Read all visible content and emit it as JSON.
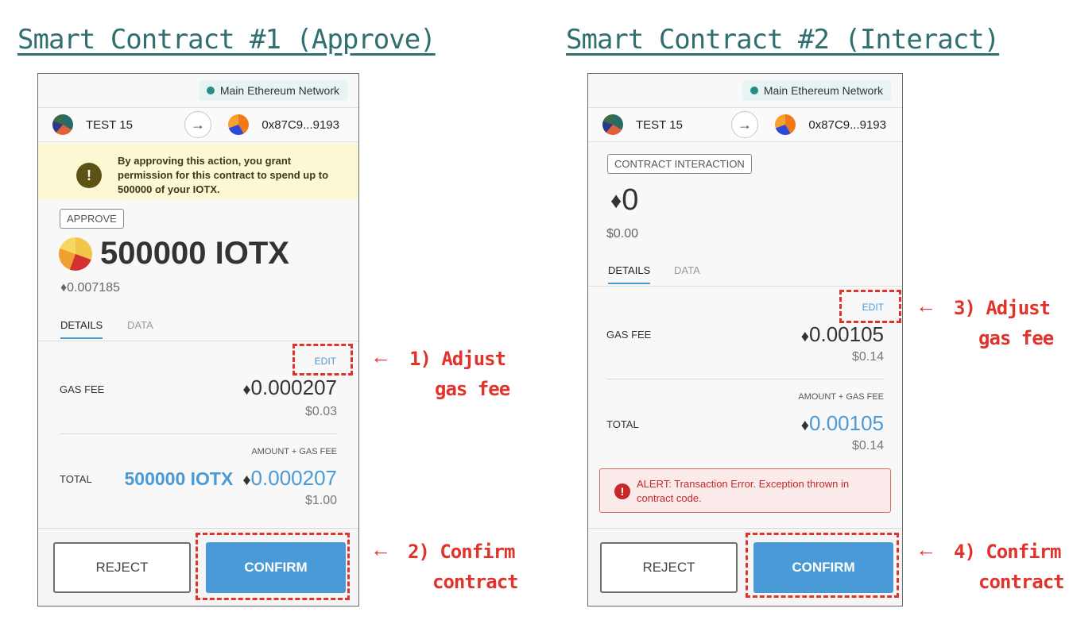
{
  "headings": {
    "left": "Smart Contract #1 (Approve)",
    "right": "Smart Contract #2 (Interact)"
  },
  "panel1": {
    "network": "Main Ethereum Network",
    "from_account": "TEST 15",
    "to_address": "0x87C9...9193",
    "warning": "By approving this action, you grant permission for this contract to spend up to 500000 of your IOTX.",
    "tag": "APPROVE",
    "amount": "500000 IOTX",
    "eth_amount": "0.007185",
    "tabs": [
      "DETAILS",
      "DATA"
    ],
    "edit": "EDIT",
    "gas_fee_label": "GAS FEE",
    "gas_fee_eth": "0.000207",
    "gas_fee_usd": "$0.03",
    "amount_gas_label": "AMOUNT + GAS FEE",
    "total_label": "TOTAL",
    "total_token": "500000 IOTX",
    "total_eth": "0.000207",
    "total_usd": "$1.00",
    "reject": "REJECT",
    "confirm": "CONFIRM"
  },
  "panel2": {
    "network": "Main Ethereum Network",
    "from_account": "TEST 15",
    "to_address": "0x87C9...9193",
    "tag": "CONTRACT INTERACTION",
    "amount": "0",
    "usd_amount": "$0.00",
    "tabs": [
      "DETAILS",
      "DATA"
    ],
    "edit": "EDIT",
    "gas_fee_label": "GAS FEE",
    "gas_fee_eth": "0.00105",
    "gas_fee_usd": "$0.14",
    "amount_gas_label": "AMOUNT + GAS FEE",
    "total_label": "TOTAL",
    "total_eth": "0.00105",
    "total_usd": "$0.14",
    "alert": "ALERT: Transaction Error. Exception thrown in contract code.",
    "reject": "REJECT",
    "confirm": "CONFIRM"
  },
  "annotations": {
    "a1_line1": "1) Adjust",
    "a1_line2": "gas fee",
    "a2_line1": "2) Confirm",
    "a2_line2": "contract",
    "a3_line1": "3) Adjust",
    "a3_line2": "gas fee",
    "a4_line1": "4) Confirm",
    "a4_line2": "contract",
    "arrow": "←"
  },
  "colors": {
    "heading": "#2f6f6f",
    "annotation": "#e0332c",
    "accent_blue": "#4a9ad8",
    "alert_red": "#c62828"
  }
}
